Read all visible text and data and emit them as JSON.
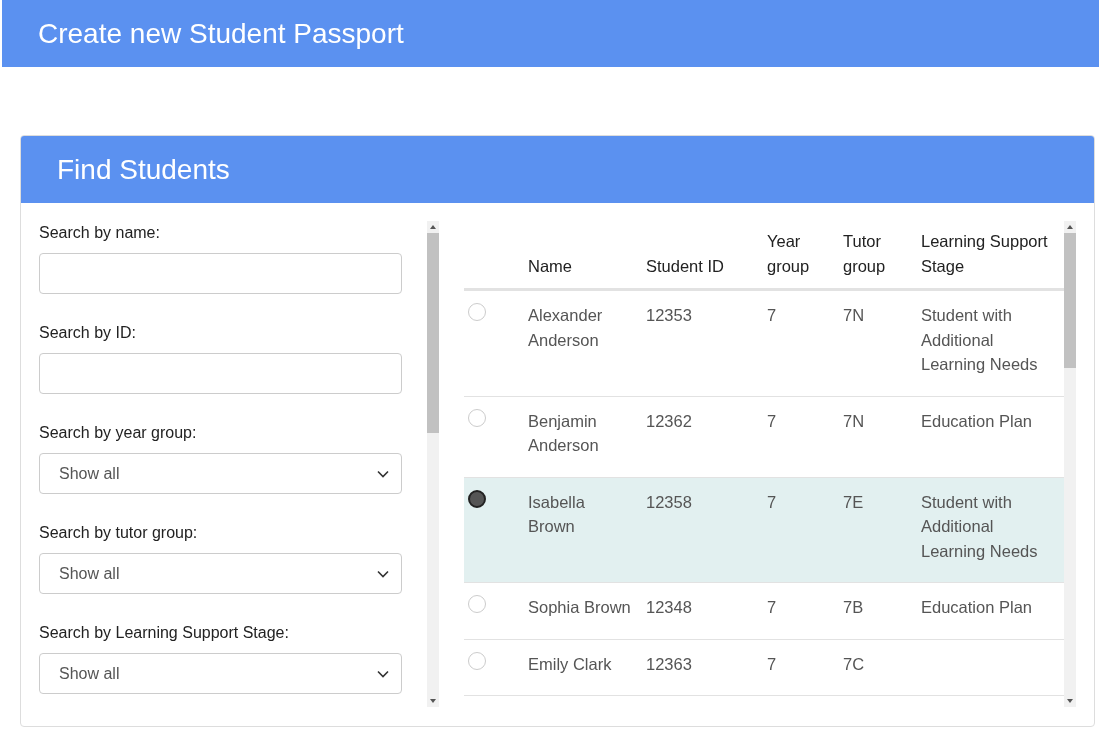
{
  "page_title": "Create new Student Passport",
  "panel": {
    "title": "Find Students",
    "filters": [
      {
        "kind": "text",
        "label": "Search by name:"
      },
      {
        "kind": "text",
        "label": "Search by ID:"
      },
      {
        "kind": "select",
        "label": "Search by year group:",
        "value": "Show all"
      },
      {
        "kind": "select",
        "label": "Search by tutor group:",
        "value": "Show all"
      },
      {
        "kind": "select",
        "label": "Search by Learning Support Stage:",
        "value": "Show all"
      }
    ],
    "table": {
      "columns": [
        "Name",
        "Student ID",
        "Year group",
        "Tutor group",
        "Learning Support Stage"
      ],
      "rows": [
        {
          "selected": false,
          "cells": [
            "Alexander Anderson",
            "12353",
            "7",
            "7N",
            "Student with Additional Learning Needs"
          ]
        },
        {
          "selected": false,
          "cells": [
            "Benjamin Anderson",
            "12362",
            "7",
            "7N",
            "Education Plan"
          ]
        },
        {
          "selected": true,
          "cells": [
            "Isabella Brown",
            "12358",
            "7",
            "7E",
            "Student with Additional Learning Needs"
          ]
        },
        {
          "selected": false,
          "cells": [
            "Sophia Brown",
            "12348",
            "7",
            "7B",
            "Education Plan"
          ]
        },
        {
          "selected": false,
          "cells": [
            "Emily Clark",
            "12363",
            "7",
            "7C",
            ""
          ]
        }
      ]
    }
  }
}
